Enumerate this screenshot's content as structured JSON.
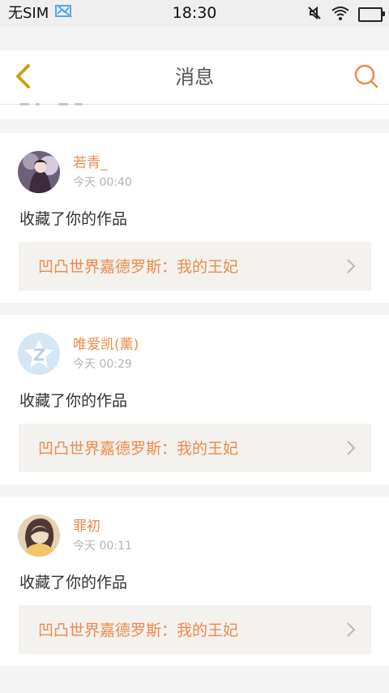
{
  "status_bar": {
    "sim_text": "无SIM",
    "time": "18:30",
    "battery_level": 1.0
  },
  "header": {
    "title": "消息"
  },
  "icons": {
    "back": "back-chevron-icon",
    "search": "search-icon",
    "chevron_right": "chevron-right-icon",
    "mute": "mute-icon",
    "wifi": "wifi-icon",
    "battery": "battery-icon",
    "no_signal": "no-signal-icon"
  },
  "colors": {
    "accent": "#f08a4b",
    "nav_back_icon": "#c9a10f",
    "background": "#f4f4f4",
    "card_background": "#ffffff",
    "link_background": "#f3f2ef"
  },
  "messages": [
    {
      "user": "若青_",
      "time": "今天 00:40",
      "action": "收藏了你的作品",
      "work_title": "凹凸世界嘉德罗斯：我的王妃"
    },
    {
      "user": "唯爱凯(薰)",
      "time": "今天 00:29",
      "action": "收藏了你的作品",
      "work_title": "凹凸世界嘉德罗斯：我的王妃"
    },
    {
      "user": "罪初",
      "time": "今天 00:11",
      "action": "收藏了你的作品",
      "work_title": "凹凸世界嘉德罗斯：我的王妃"
    }
  ]
}
